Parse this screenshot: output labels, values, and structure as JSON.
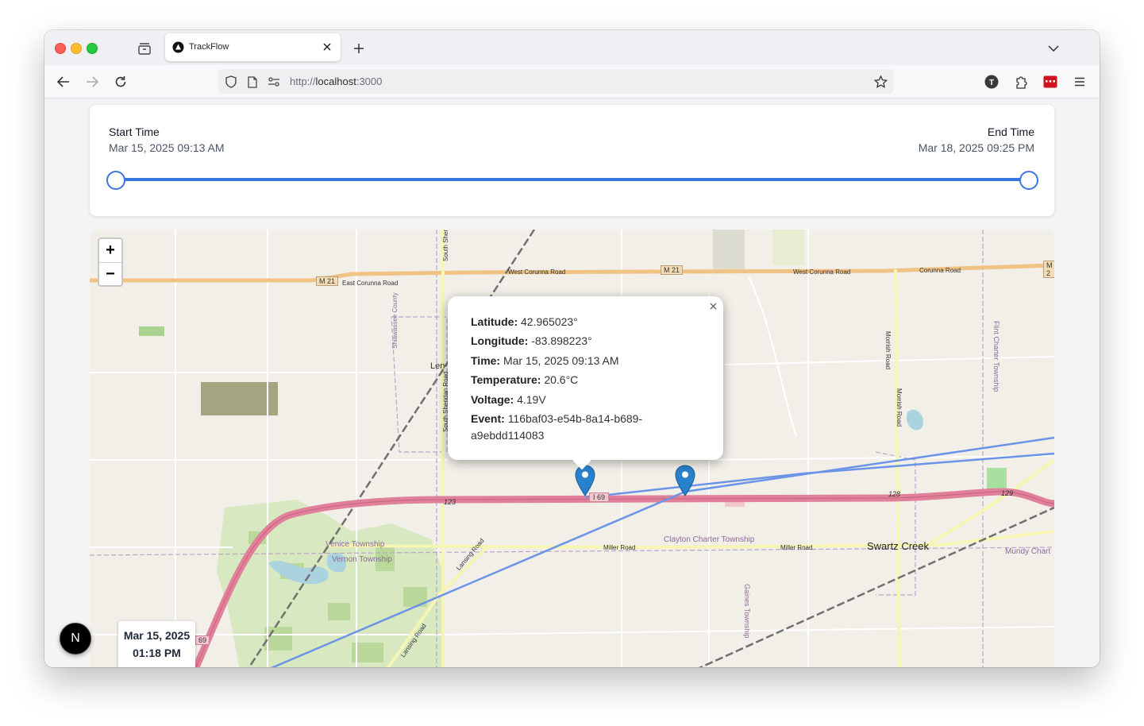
{
  "browser": {
    "tab_title": "TrackFlow",
    "url_scheme": "http://",
    "url_host": "localhost",
    "url_port": ":3000",
    "profile_initial": "T"
  },
  "time_range": {
    "start_label": "Start Time",
    "start_value": "Mar 15, 2025 09:13 AM",
    "end_label": "End Time",
    "end_value": "Mar 18, 2025 09:25 PM",
    "slider_start_fraction": 0.0,
    "slider_end_fraction": 1.0,
    "accent_color": "#3b76e0"
  },
  "map": {
    "zoom_in_label": "+",
    "zoom_out_label": "−",
    "labels": {
      "m21_shield": "M 21",
      "east_corunna": "East Corunna Road",
      "west_corunna_1": "West Corunna Road",
      "west_corunna_2": "West Corunna Road",
      "corunna": "Corunna Road",
      "m21_shield_2": "M 21",
      "m_edge": "M 2",
      "shiawassee": "Shiawassee County",
      "south_sheridan": "South Sheridan Road",
      "south_sheri_top": "South Sheri",
      "lennon": "Len",
      "morrish_1": "Morrish Road",
      "morrish_2": "Morrish Road",
      "flint_charter": "Flint Charter Township",
      "i69_shield": "I 69",
      "exit_123": "123",
      "exit_128": "128",
      "exit_129": "129",
      "venice": "Venice Township",
      "vernon": "Vernon Township",
      "clayton": "Clayton Charter Township",
      "miller_1": "Miller Road",
      "miller_2": "Miller Road",
      "swartz_creek": "Swartz Creek",
      "mundy": "Mundy Chart",
      "lansing_1": "Lansing Road",
      "lansing_2": "Lansing Road",
      "gaines": "Gaines Township",
      "i69_shield_2": "69"
    },
    "popup": {
      "latitude_label": "Latitude:",
      "latitude_value": "42.965023°",
      "longitude_label": "Longitude:",
      "longitude_value": "-83.898223°",
      "time_label": "Time:",
      "time_value": "Mar 15, 2025 09:13 AM",
      "temperature_label": "Temperature:",
      "temperature_value": "20.6°C",
      "voltage_label": "Voltage:",
      "voltage_value": "4.19V",
      "event_label": "Event:",
      "event_value_line1": "116baf03-e54b-8a14-b689-",
      "event_value_line2": "a9ebdd114083"
    },
    "marker_color": "#2a81cb",
    "track_color": "#6b94e8"
  },
  "date_badge": {
    "date": "Mar 15, 2025",
    "time": "01:18 PM"
  },
  "nextjs_badge": "N"
}
